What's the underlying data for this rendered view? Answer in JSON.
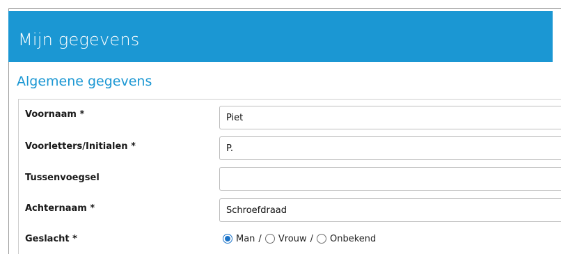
{
  "accent_color": "#1b97d3",
  "header": {
    "title": "Mijn gegevens"
  },
  "section": {
    "title": "Algemene gegevens"
  },
  "form": {
    "fields": [
      {
        "label": "Voornaam *",
        "value": "Piet"
      },
      {
        "label": "Voorletters/Initialen *",
        "value": "P."
      },
      {
        "label": "Tussenvoegsel",
        "value": ""
      },
      {
        "label": "Achternaam *",
        "value": "Schroefdraad"
      }
    ],
    "gender": {
      "label": "Geslacht *",
      "separator": "/",
      "options": [
        {
          "label": "Man",
          "selected": true
        },
        {
          "label": "Vrouw",
          "selected": false
        },
        {
          "label": "Onbekend",
          "selected": false
        }
      ]
    }
  }
}
